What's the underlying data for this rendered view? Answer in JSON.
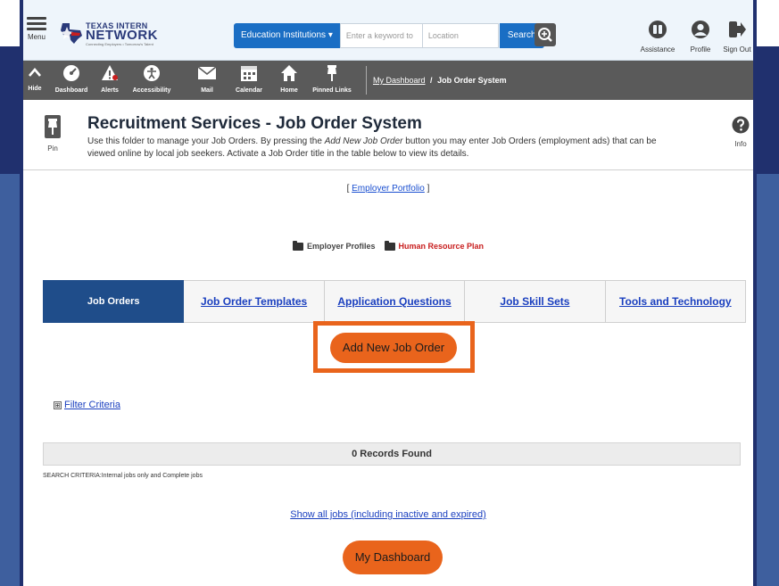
{
  "header": {
    "menu_label": "Menu",
    "logo_line1": "TEXAS INTERN",
    "logo_line2": "NETWORK",
    "logo_tagline": "Connecting Employers • Tomorrow's Talent",
    "search_category": "Education Institutions",
    "keyword_placeholder": "Enter a keyword to",
    "location_placeholder": "Location",
    "search_button": "Search",
    "links": [
      {
        "label": "Assistance",
        "icon": "assistance-icon"
      },
      {
        "label": "Profile",
        "icon": "profile-icon"
      },
      {
        "label": "Sign Out",
        "icon": "sign-out-icon"
      }
    ]
  },
  "nav": {
    "hide_label": "Hide",
    "items": [
      {
        "label": "Dashboard",
        "icon": "dashboard-icon"
      },
      {
        "label": "Alerts",
        "icon": "alert-icon"
      },
      {
        "label": "Accessibility",
        "icon": "accessibility-icon"
      },
      {
        "label": "Mail",
        "icon": "mail-icon"
      },
      {
        "label": "Calendar",
        "icon": "calendar-icon"
      },
      {
        "label": "Home",
        "icon": "home-icon"
      },
      {
        "label": "Pinned Links",
        "icon": "pin-icon"
      }
    ],
    "breadcrumb_link": "My Dashboard",
    "breadcrumb_sep": "/",
    "breadcrumb_current": "Job Order System"
  },
  "page": {
    "pin_label": "Pin",
    "info_label": "Info",
    "title": "Recruitment Services - Job Order System",
    "desc_before": "Use this folder to manage your Job Orders. By pressing the ",
    "desc_italic": "Add New Job Order",
    "desc_after": " button you may enter Job Orders (employment ads) that can be viewed online by local job seekers. Activate a Job Order title in the table below to view its details.",
    "portfolio_open": "[ ",
    "portfolio_link": "Employer Portfolio",
    "portfolio_close": " ]",
    "folder_1": "Employer Profiles",
    "folder_2": "Human Resource Plan"
  },
  "tabs": [
    {
      "label": "Job Orders",
      "active": true
    },
    {
      "label": "Job Order Templates",
      "active": false
    },
    {
      "label": "Application Questions",
      "active": false
    },
    {
      "label": "Job Skill Sets",
      "active": false
    },
    {
      "label": "Tools and Technology",
      "active": false
    }
  ],
  "actions": {
    "add_new": "Add New Job Order",
    "filter_toggle": "⊞",
    "filter_label": "Filter Criteria",
    "records": "0 Records Found",
    "criteria": "SEARCH CRITERIA:Internal jobs only and Complete jobs",
    "show_all": "Show all jobs (including inactive and expired)",
    "dashboard": "My Dashboard"
  },
  "colors": {
    "accent_orange": "#e9641c",
    "active_tab": "#1f4d8a",
    "nav_bar": "#5a5a5a",
    "link_blue": "#1a3fbf"
  }
}
